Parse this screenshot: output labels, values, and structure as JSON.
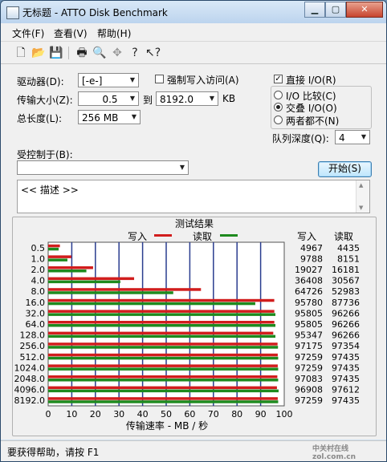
{
  "window": {
    "title": "无标题 - ATTO Disk Benchmark"
  },
  "menu": [
    {
      "label": "文件(F)"
    },
    {
      "label": "查看(V)"
    },
    {
      "label": "帮助(H)"
    }
  ],
  "toolbar": {
    "icons": [
      "new-file-icon",
      "open-folder-icon",
      "save-icon",
      "print-icon",
      "print-preview-icon",
      "move-icon",
      "help-icon",
      "context-help-icon"
    ]
  },
  "form": {
    "drive_label": "驱动器(D):",
    "drive_value": "[-e-]",
    "force_write_label": "强制写入访问(A)",
    "force_write_checked": false,
    "direct_io_label": "直接 I/O(R)",
    "direct_io_checked": true,
    "transfer_label": "传输大小(Z):",
    "transfer_from": "0.5",
    "transfer_to_label": "到",
    "transfer_to": "8192.0",
    "transfer_unit": "KB",
    "io_compare_label": "I/O 比较(C)",
    "overlapped_io_label": "交叠 I/O(O)",
    "neither_label": "两者都不(N)",
    "total_length_label": "总长度(L):",
    "total_length_value": "256 MB",
    "queue_depth_label": "队列深度(Q):",
    "queue_depth_value": "4",
    "controlled_by_label": "受控制于(B):",
    "controlled_by_value": "",
    "start_button": "开始(S)",
    "description": "<< 描述 >>"
  },
  "results": {
    "title": "测试结果",
    "legend_write": "写入",
    "legend_read": "读取",
    "col_write": "写入",
    "col_read": "读取",
    "xaxis_label": "传输速率 - MB / 秒",
    "x_ticks": [
      "0",
      "10",
      "20",
      "30",
      "40",
      "50",
      "60",
      "70",
      "80",
      "90",
      "100"
    ],
    "write_color": "#d11d1d",
    "read_color": "#1e8a1e"
  },
  "chart_data": {
    "type": "bar",
    "orientation": "horizontal",
    "categories": [
      "0.5",
      "1.0",
      "2.0",
      "4.0",
      "8.0",
      "16.0",
      "32.0",
      "64.0",
      "128.0",
      "256.0",
      "512.0",
      "1024.0",
      "2048.0",
      "4096.0",
      "8192.0"
    ],
    "series": [
      {
        "name": "写入",
        "values": [
          4967,
          9788,
          19027,
          36408,
          64726,
          95780,
          95805,
          95805,
          95347,
          97175,
          97259,
          97259,
          97083,
          96908,
          97259
        ]
      },
      {
        "name": "读取",
        "values": [
          4435,
          8151,
          16181,
          30567,
          52983,
          87736,
          96266,
          96266,
          96266,
          97354,
          97435,
          97435,
          97435,
          97612,
          97435
        ]
      }
    ],
    "xlabel": "传输速率 - MB / 秒",
    "xlim": [
      0,
      100
    ],
    "grid": true,
    "legend": "top"
  },
  "statusbar": {
    "text": "要获得帮助，请按 F1",
    "watermark": "中关村在线 zol.com.cn"
  }
}
